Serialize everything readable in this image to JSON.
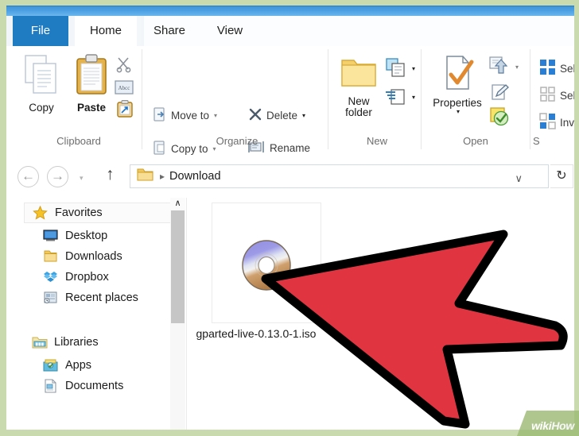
{
  "window": {
    "title_bar_color": "#4ea2e4",
    "frame_color": "#c9dbae"
  },
  "tabs": [
    {
      "id": "file",
      "label": "File",
      "active": false,
      "accent": "#1f7cc2"
    },
    {
      "id": "home",
      "label": "Home",
      "active": true
    },
    {
      "id": "share",
      "label": "Share",
      "active": false
    },
    {
      "id": "view",
      "label": "View",
      "active": false
    }
  ],
  "ribbon": {
    "groups": [
      {
        "id": "clipboard",
        "label": "Clipboard",
        "buttons": [
          {
            "id": "copy",
            "label": "Copy",
            "icon": "copy-icon"
          },
          {
            "id": "paste",
            "label": "Paste",
            "icon": "paste-icon"
          },
          {
            "id": "cut",
            "label": "",
            "icon": "scissors-icon"
          },
          {
            "id": "copy-path",
            "label": "",
            "icon": "copy-path-icon"
          },
          {
            "id": "paste-shortcut",
            "label": "",
            "icon": "paste-shortcut-icon"
          }
        ]
      },
      {
        "id": "organize",
        "label": "Organize",
        "buttons": [
          {
            "id": "move-to",
            "label": "Move to",
            "icon": "move-to-icon",
            "caret": "▾"
          },
          {
            "id": "copy-to",
            "label": "Copy to",
            "icon": "copy-to-icon",
            "caret": "▾"
          },
          {
            "id": "delete",
            "label": "Delete",
            "icon": "delete-x-icon",
            "caret": "▾"
          },
          {
            "id": "rename",
            "label": "Rename",
            "icon": "rename-icon",
            "caret": ""
          }
        ]
      },
      {
        "id": "new",
        "label": "New",
        "buttons": [
          {
            "id": "new-folder",
            "label": "New\nfolder",
            "icon": "new-folder-icon"
          },
          {
            "id": "new-item",
            "label": "",
            "icon": "new-item-icon",
            "caret": "▾"
          },
          {
            "id": "easy-access",
            "label": "",
            "icon": "easy-access-icon",
            "caret": "▾"
          }
        ]
      },
      {
        "id": "open",
        "label": "Open",
        "buttons": [
          {
            "id": "properties",
            "label": "Properties",
            "icon": "properties-icon",
            "caret": "▾"
          },
          {
            "id": "open-with",
            "label": "",
            "icon": "open-with-icon",
            "caret": "▾"
          },
          {
            "id": "edit",
            "label": "",
            "icon": "edit-icon"
          },
          {
            "id": "history",
            "label": "",
            "icon": "history-icon"
          }
        ]
      },
      {
        "id": "select",
        "label": "S",
        "buttons": [
          {
            "id": "select-all",
            "label": "Sel",
            "icon": "select-all-icon"
          },
          {
            "id": "select-none",
            "label": "Sel",
            "icon": "select-none-icon"
          },
          {
            "id": "invert-selection",
            "label": "Inv",
            "icon": "invert-selection-icon"
          }
        ]
      }
    ]
  },
  "addressbar": {
    "back_glyph": "←",
    "forward_glyph": "→",
    "recent_glyph": "▾",
    "up_glyph": "↑",
    "folder_icon": "folder-icon",
    "separator_glyph": "▸",
    "crumb": "Download",
    "dropdown_glyph": "∨",
    "refresh_glyph": "↻"
  },
  "navpane": {
    "items": [
      {
        "id": "favorites",
        "label": "Favorites",
        "icon": "star-icon",
        "level": 0,
        "highlight": true
      },
      {
        "id": "desktop",
        "label": "Desktop",
        "icon": "desktop-icon",
        "level": 1
      },
      {
        "id": "downloads",
        "label": "Downloads",
        "icon": "downloads-folder-icon",
        "level": 1
      },
      {
        "id": "dropbox",
        "label": "Dropbox",
        "icon": "dropbox-icon",
        "level": 1
      },
      {
        "id": "recent-places",
        "label": "Recent places",
        "icon": "recent-places-icon",
        "level": 1
      },
      {
        "id": "libraries",
        "label": "Libraries",
        "icon": "libraries-icon",
        "level": 0
      },
      {
        "id": "apps",
        "label": "Apps",
        "icon": "apps-icon",
        "level": 1
      },
      {
        "id": "documents",
        "label": "Documents",
        "icon": "documents-icon",
        "level": 1
      }
    ],
    "scrollbar": {
      "up_glyph": "∧"
    }
  },
  "content": {
    "files": [
      {
        "id": "gparted-iso",
        "name": "gparted-live-0.13.0-1.iso",
        "icon": "disc-image-icon"
      }
    ]
  },
  "annotation": {
    "cursor": {
      "type": "red-arrow-cursor",
      "fill": "#e03541",
      "stroke": "#000000"
    }
  },
  "watermark": {
    "wiki": "wiki",
    "how": "How"
  }
}
